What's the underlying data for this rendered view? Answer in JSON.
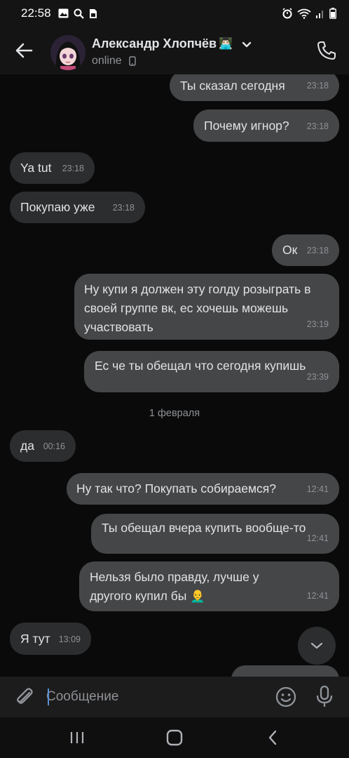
{
  "status_bar": {
    "time": "22:58"
  },
  "header": {
    "contact_name": "Александр Хлопчёв",
    "contact_emoji": "👨🏻‍💻",
    "status": "online"
  },
  "messages": [
    {
      "dir": "out",
      "text": "Ты сказал сегодня",
      "time": "23:18"
    },
    {
      "dir": "out",
      "text": "Почему игнор?",
      "time": "23:18"
    },
    {
      "dir": "in",
      "text": "Ya tut",
      "time": "23:18"
    },
    {
      "dir": "in",
      "text": "Покупаю уже",
      "time": "23:18"
    },
    {
      "dir": "out",
      "text": "Ок",
      "time": "23:18"
    },
    {
      "dir": "out",
      "text": "Ну купи я должен эту голду розыграть в своей группе вк, ес хочешь можешь участвовать",
      "time": "23:19"
    },
    {
      "dir": "out",
      "text": "Ес че ты обещал что сегодня купишь",
      "time": "23:39"
    },
    {
      "dir": "in",
      "text": "да",
      "time": "00:16"
    },
    {
      "dir": "out",
      "text": "Ну так что? Покупать собираемся?",
      "time": "12:41"
    },
    {
      "dir": "out",
      "text": "Ты обещал вчера купить вообще-то",
      "time": "12:41"
    },
    {
      "dir": "out",
      "text": "Нельзя было правду, лучше у другого купил бы 👨‍🦲",
      "time": "12:41"
    },
    {
      "dir": "in",
      "text": "Я тут",
      "time": "13:09"
    }
  ],
  "date_separator": "1 февраля",
  "composer": {
    "placeholder": "Сообщение"
  }
}
